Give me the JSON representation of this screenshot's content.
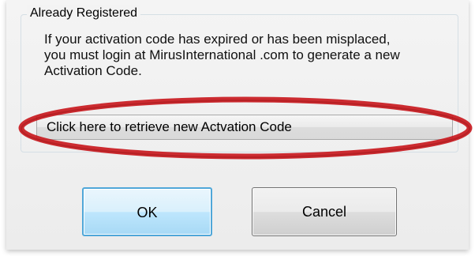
{
  "group": {
    "title": "Already Registered",
    "message_line1": "If your activation code has expired or has been misplaced,",
    "message_line2": "you must login at MirusInternational .com to generate a new",
    "message_line3": "Activation Code."
  },
  "retrieve_button": {
    "label": "Click here to retrieve new Actvation Code"
  },
  "buttons": {
    "ok_label": "OK",
    "cancel_label": "Cancel"
  },
  "colors": {
    "highlight_ellipse": "#c8151b",
    "ok_border": "#4fa7d9"
  }
}
